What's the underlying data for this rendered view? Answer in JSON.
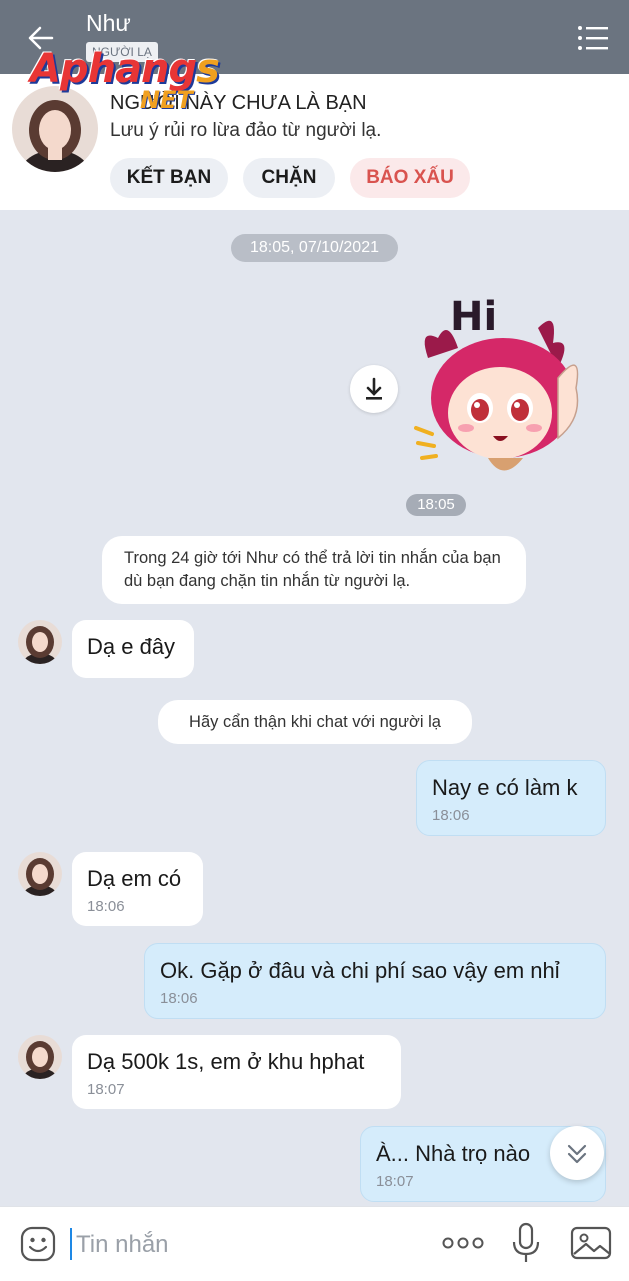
{
  "header": {
    "name": "Như",
    "badge": "NGƯỜI LẠ",
    "watermark": "Aphang",
    "watermark_accent": "s",
    "watermark_sub": "NET"
  },
  "stranger_card": {
    "title": "NGƯỜI NÀY CHƯA LÀ BẠN",
    "subtitle": "Lưu ý rủi ro lừa đảo từ người lạ.",
    "add_friend_label": "KẾT BẠN",
    "block_label": "CHẶN",
    "report_label": "BÁO XẤU"
  },
  "chat": {
    "date": "18:05, 07/10/2021",
    "sticker_time": "18:05",
    "system_notice_1": "Trong 24 giờ tới Như có thể trả lời tin nhắn của bạn dù bạn đang chặn tin nhắn từ người lạ.",
    "system_notice_2": "Hãy cẩn thận khi chat với người lạ",
    "messages": [
      {
        "text": "Dạ e đây",
        "time": ""
      },
      {
        "text": "Nay e có làm k",
        "time": "18:06"
      },
      {
        "text": "Dạ em có",
        "time": "18:06"
      },
      {
        "text": "Ok. Gặp ở đâu và chi phí sao vậy em nhỉ",
        "time": "18:06"
      },
      {
        "text": "Dạ 500k 1s, em ở khu hphat",
        "time": "18:07"
      },
      {
        "text": "À... Nhà trọ nào",
        "time": "18:07"
      }
    ]
  },
  "input": {
    "placeholder": "Tin nhắn"
  },
  "colors": {
    "header_bg": "#6b7480",
    "chat_bg": "#e2e6ee",
    "outgoing_bubble": "#d5ecfb",
    "report_text": "#d9534f",
    "caret": "#1e88e5"
  },
  "icons": [
    "back-arrow-icon",
    "menu-list-icon",
    "download-icon",
    "emoji-icon",
    "more-dots-icon",
    "microphone-icon",
    "image-icon",
    "chevron-double-down-icon"
  ]
}
